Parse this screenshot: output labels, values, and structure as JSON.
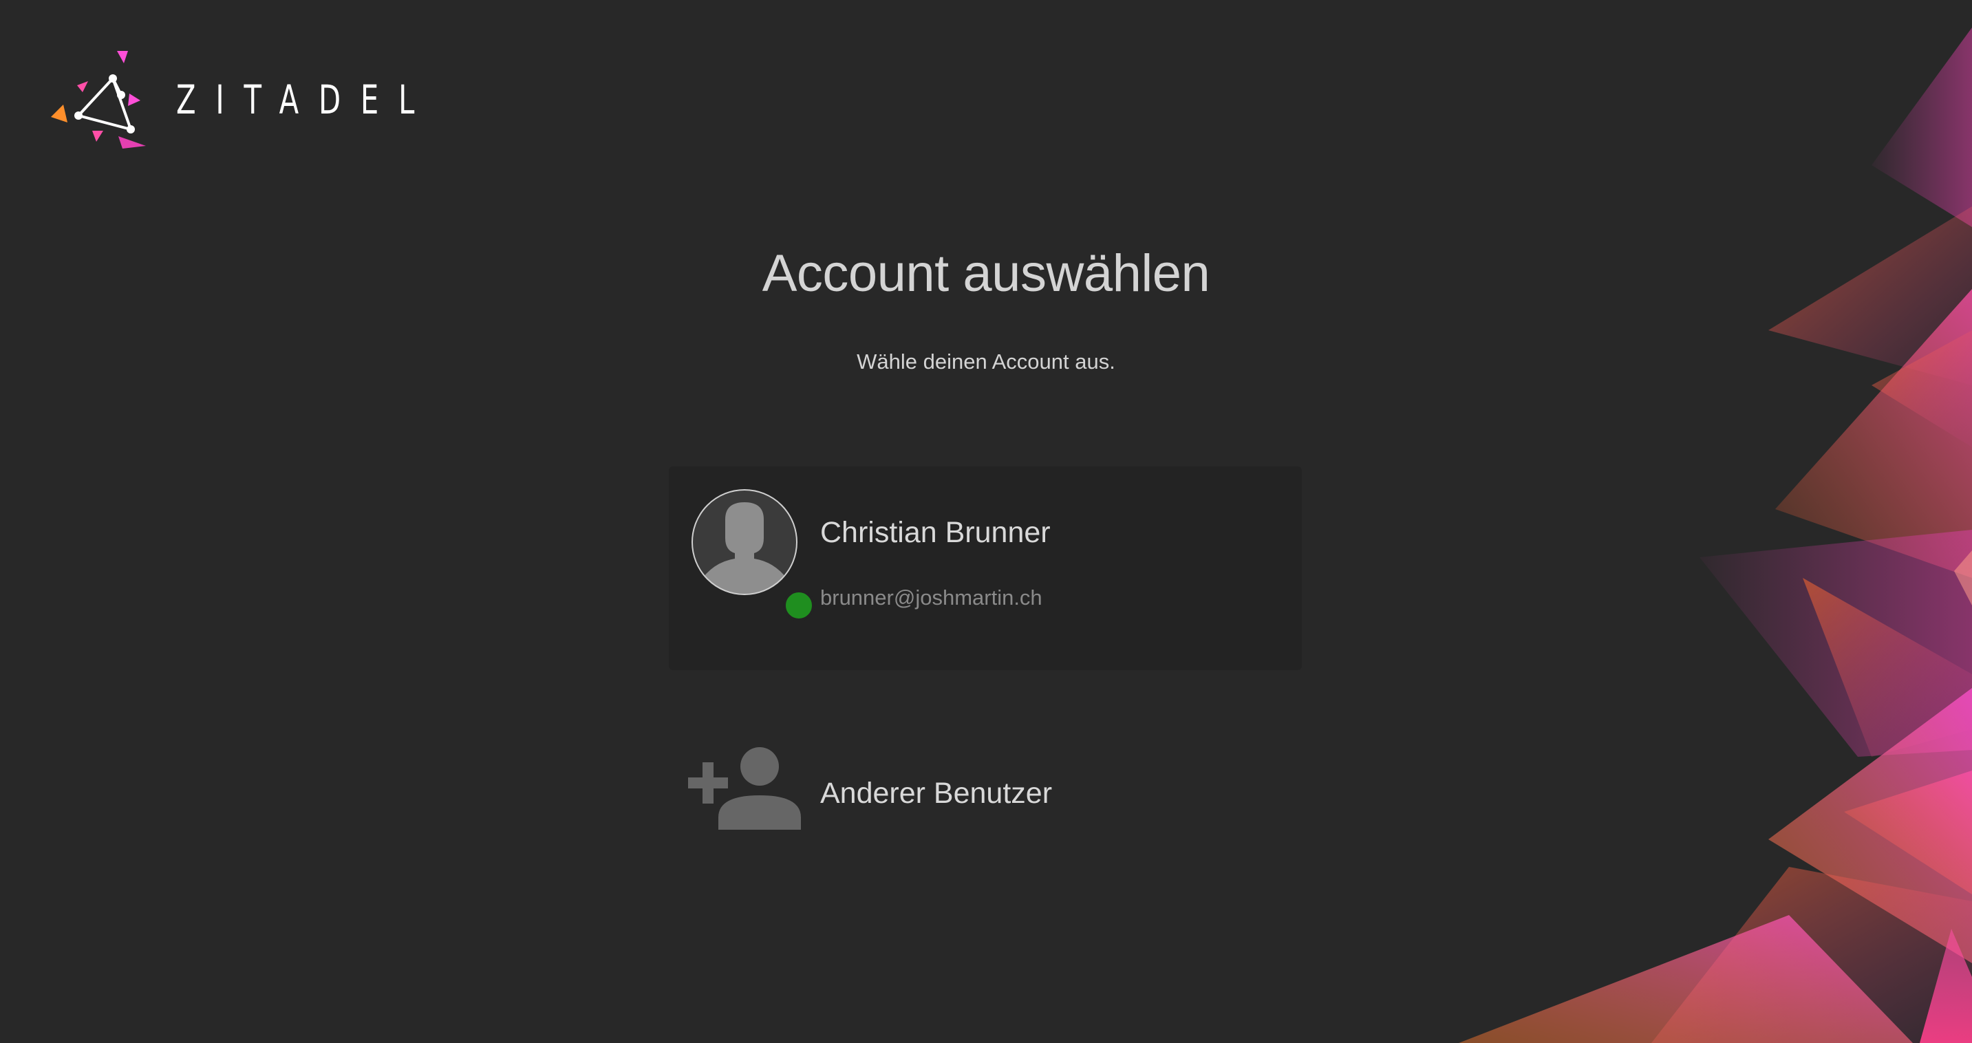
{
  "brand": {
    "logo_text": "ZITADEL",
    "accent_colors": [
      "#ff8f2b",
      "#e440b1",
      "#ff4fd8"
    ]
  },
  "header": {
    "title": "Account auswählen",
    "subtitle": "Wähle deinen Account aus."
  },
  "accounts": [
    {
      "name": "Christian Brunner",
      "email": "brunner@joshmartin.ch",
      "avatar_icon": "user-silhouette-icon",
      "status": "active",
      "status_color": "#1f8e1f"
    }
  ],
  "actions": {
    "other_user_label": "Anderer Benutzer",
    "other_user_icon": "add-user-icon"
  },
  "theme": {
    "background": "#282828",
    "card_background": "#232323",
    "text_primary": "#d9d9d9",
    "text_secondary": "#8a8a8a"
  }
}
